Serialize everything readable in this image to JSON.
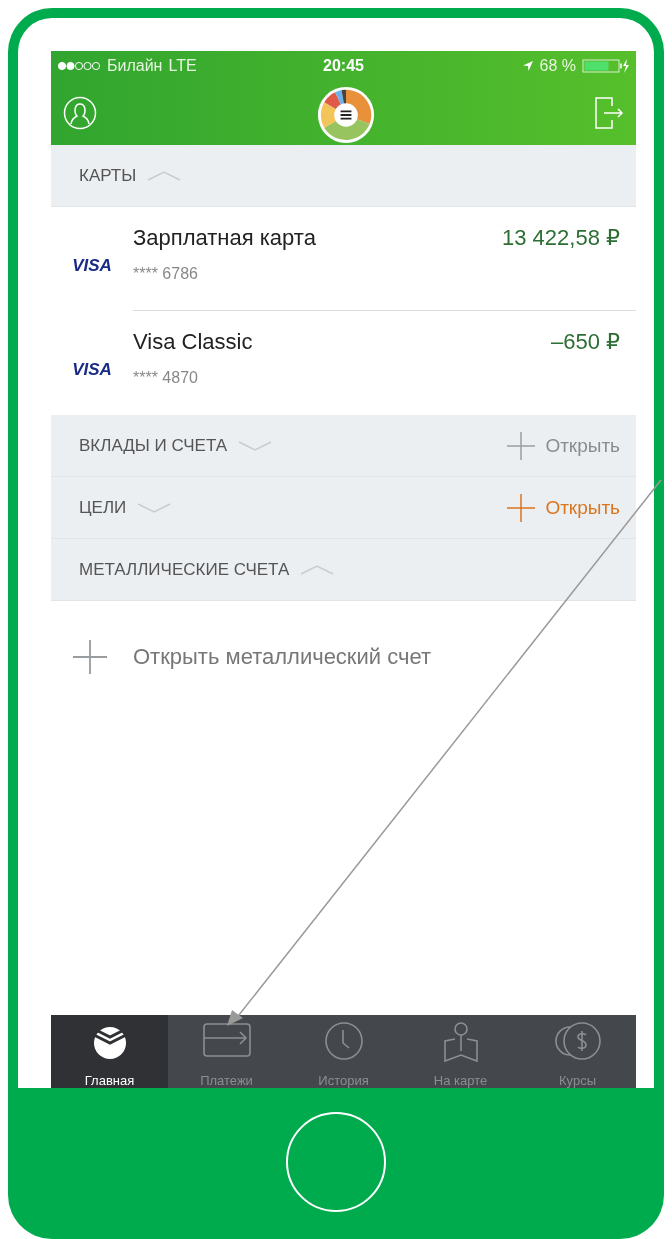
{
  "status_bar": {
    "carrier": "Билайн",
    "network": "LTE",
    "time": "20:45",
    "battery": "68 %"
  },
  "sections": [
    {
      "title": "КАРТЫ",
      "expanded": true,
      "items": [
        {
          "kind": "card",
          "logo": "VISA",
          "name": "Зарплатная карта",
          "number": "**** 6786",
          "amount": "13 422,58 ₽"
        },
        {
          "kind": "card",
          "logo": "VISA",
          "name": "Visa Classic",
          "number": "**** 4870",
          "amount": "–650 ₽"
        }
      ]
    },
    {
      "title": "ВКЛАДЫ И СЧЕТА",
      "expanded": false,
      "action": {
        "label": "Открыть",
        "highlighted": false
      }
    },
    {
      "title": "ЦЕЛИ",
      "expanded": false,
      "action": {
        "label": "Открыть",
        "highlighted": true
      }
    },
    {
      "title": "МЕТАЛЛИЧЕСКИЕ СЧЕТА",
      "expanded": true,
      "items": [
        {
          "kind": "add",
          "name": "Открыть металлический счет"
        }
      ]
    }
  ],
  "tabs": [
    {
      "kind": "home",
      "label": "Главная",
      "selected": true
    },
    {
      "kind": "payments",
      "label": "Платежи",
      "selected": false
    },
    {
      "kind": "history",
      "label": "История",
      "selected": false
    },
    {
      "kind": "map",
      "label": "На карте",
      "selected": false
    },
    {
      "kind": "rates",
      "label": "Курсы",
      "selected": false
    }
  ]
}
